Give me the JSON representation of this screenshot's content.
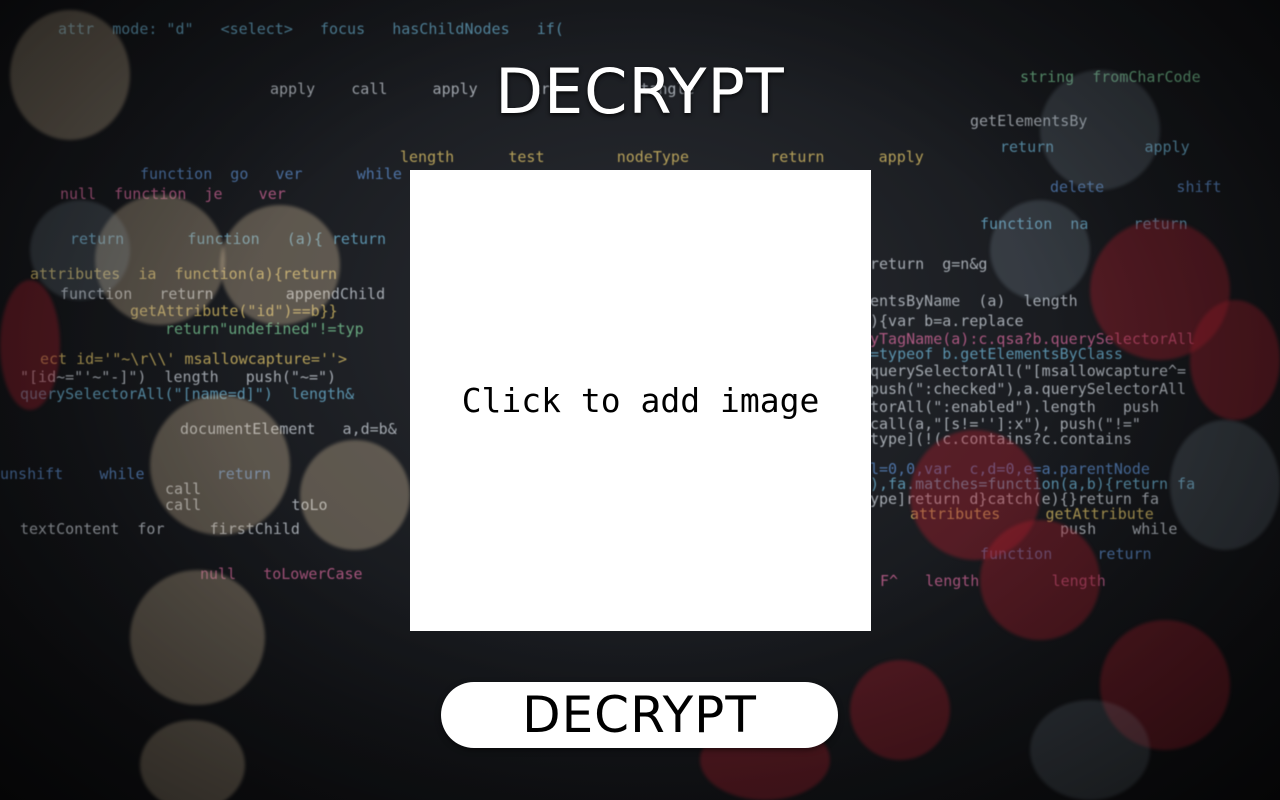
{
  "app": {
    "title": "DECRYPT"
  },
  "image_area": {
    "label": "Click to add image"
  },
  "actions": {
    "decrypt_label": "DECRYPT"
  },
  "colors": {
    "button_background": "#ffffff",
    "image_area_background": "#ffffff",
    "title_text": "#ffffff"
  }
}
